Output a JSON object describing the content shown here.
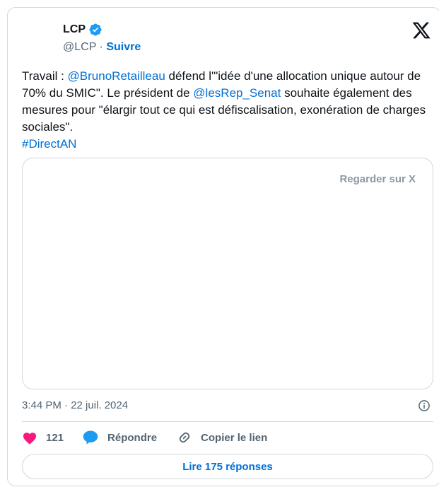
{
  "author": {
    "name": "LCP",
    "handle": "@LCP",
    "separator": "·",
    "follow_label": "Suivre"
  },
  "tweet": {
    "text_1": "Travail : ",
    "mention_1": "@BrunoRetailleau",
    "text_2": " défend l'\"idée d'une allocation unique autour de 70% du SMIC\". Le président de ",
    "mention_2": "@lesRep_Senat",
    "text_3": " souhaite également des mesures pour \"élargir tout ce qui est défiscalisation, exonération de charges sociales\".",
    "hashtag": "#DirectAN"
  },
  "media": {
    "watch_label": "Regarder sur X"
  },
  "meta": {
    "timestamp": "3:44 PM · 22 juil. 2024"
  },
  "actions": {
    "like_count": "121",
    "reply_label": "Répondre",
    "copy_link_label": "Copier le lien",
    "read_replies_label": "Lire 175 réponses"
  },
  "icons": {
    "verified": "verified-badge-icon",
    "logo": "x-logo-icon",
    "info": "info-icon",
    "like": "heart-icon",
    "reply": "speech-bubble-icon",
    "link": "link-icon"
  },
  "colors": {
    "link": "#006fd6",
    "verified": "#1d9bf0",
    "like": "#f91880",
    "muted": "#536471",
    "border": "#cfd9de",
    "watch_label": "#8b98a5"
  }
}
